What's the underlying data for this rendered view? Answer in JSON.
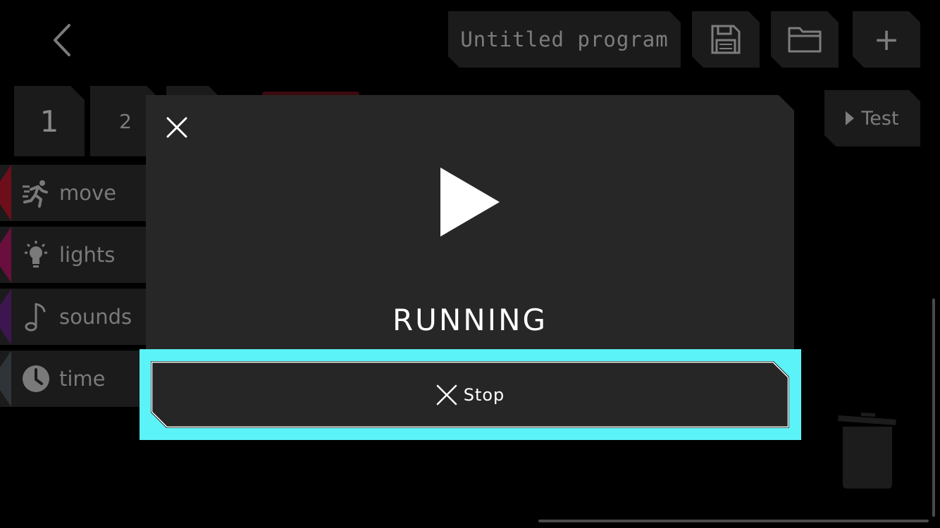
{
  "header": {
    "program_title": "Untitled program",
    "add_label": "+",
    "test_label": "Test"
  },
  "tabs": [
    "1",
    "2"
  ],
  "categories": [
    {
      "label": "move",
      "color": "#6e0e1a"
    },
    {
      "label": "lights",
      "color": "#6a0f3d"
    },
    {
      "label": "sounds",
      "color": "#3d1650"
    },
    {
      "label": "time",
      "color": "#2f3438"
    }
  ],
  "modal": {
    "status": "RUNNING",
    "stop_label": "Stop",
    "highlight_color": "#5cf3f8"
  },
  "icons": {
    "back": "chevron-left-icon",
    "save": "floppy-disk-icon",
    "open": "folder-icon",
    "add": "plus-icon",
    "test": "play-small-icon",
    "move": "running-person-icon",
    "lights": "light-bulb-icon",
    "sounds": "music-note-icon",
    "time": "clock-icon",
    "trash": "trash-can-icon",
    "close": "close-icon",
    "play": "play-icon",
    "stop": "close-icon"
  }
}
